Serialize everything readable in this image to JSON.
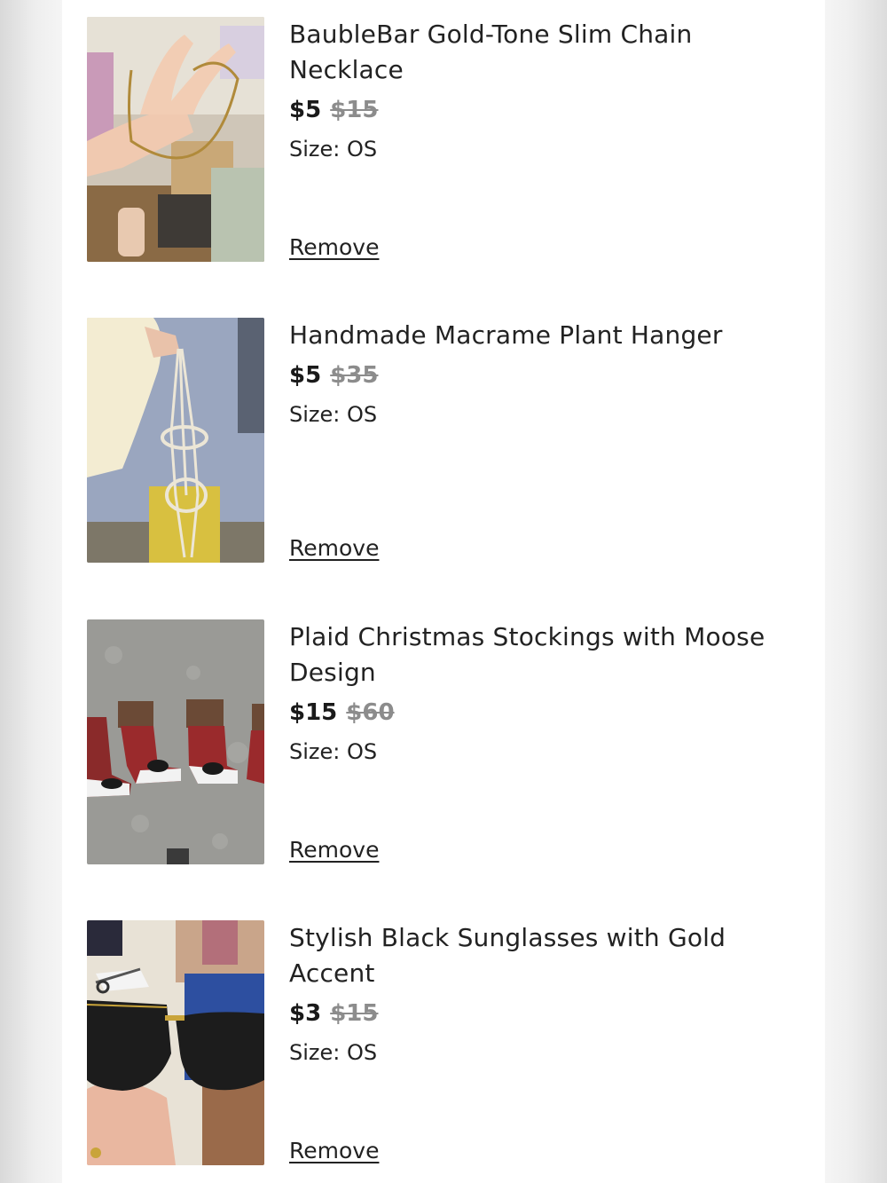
{
  "items": [
    {
      "title": "BaubleBar Gold-Tone Slim Chain Necklace",
      "price": "$5",
      "original_price": "$15",
      "size": "Size: OS",
      "remove_label": "Remove"
    },
    {
      "title": "Handmade Macrame Plant Hanger",
      "price": "$5",
      "original_price": "$35",
      "size": "Size: OS",
      "remove_label": "Remove"
    },
    {
      "title": "Plaid Christmas Stockings with Moose Design",
      "price": "$15",
      "original_price": "$60",
      "size": "Size: OS",
      "remove_label": "Remove"
    },
    {
      "title": "Stylish Black Sunglasses with Gold Accent",
      "price": "$3",
      "original_price": "$15",
      "size": "Size: OS",
      "remove_label": "Remove"
    }
  ]
}
